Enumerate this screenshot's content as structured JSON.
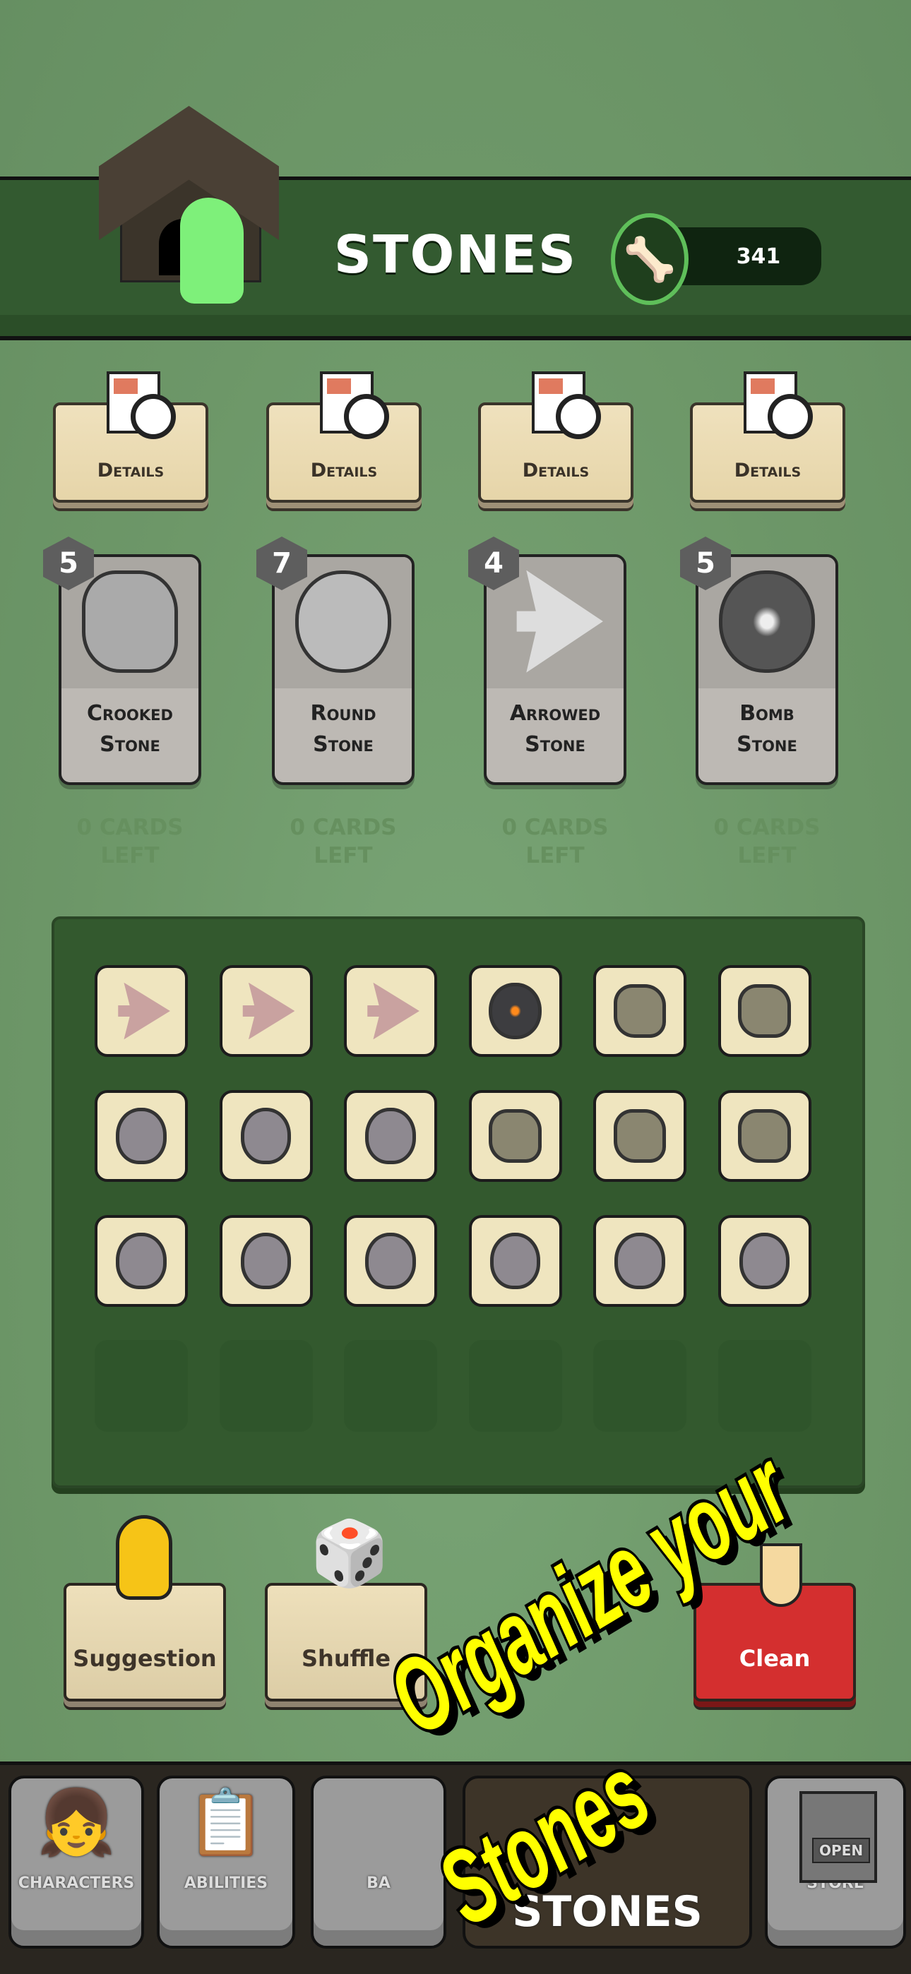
{
  "header": {
    "title": "STONES",
    "currency_value": "341",
    "currency_icon": "bone-icon"
  },
  "stones": [
    {
      "details_label": "Details",
      "count": "5",
      "name_line1": "Crooked",
      "name_line2": "Stone",
      "cards_left": "0 CARDS",
      "cards_left2": "LEFT"
    },
    {
      "details_label": "Details",
      "count": "7",
      "name_line1": "Round",
      "name_line2": "Stone",
      "cards_left": "0 CARDS",
      "cards_left2": "LEFT"
    },
    {
      "details_label": "Details",
      "count": "4",
      "name_line1": "Arrowed",
      "name_line2": "Stone",
      "cards_left": "0 CARDS",
      "cards_left2": "LEFT"
    },
    {
      "details_label": "Details",
      "count": "5",
      "name_line1": "Bomb",
      "name_line2": "Stone",
      "cards_left": "0 CARDS",
      "cards_left2": "LEFT"
    }
  ],
  "grid": [
    [
      "arrowed",
      "arrowed",
      "arrowed",
      "bomb",
      "crooked",
      "crooked"
    ],
    [
      "round",
      "round",
      "round",
      "crooked",
      "crooked",
      "crooked"
    ],
    [
      "round",
      "round",
      "round",
      "round",
      "round",
      "round"
    ],
    [
      "empty",
      "empty",
      "empty",
      "empty",
      "empty",
      "empty"
    ]
  ],
  "actions": {
    "suggestion": "Suggestion",
    "shuffle": "Shuffle",
    "clean": "Clean"
  },
  "nav": {
    "characters": "CHARACTERS",
    "abilities": "ABILITIES",
    "third": "BA",
    "stones": "STONES",
    "store": "STORE",
    "store_sign": "OPEN"
  },
  "overlay": {
    "line1": "Organize your",
    "line2": "Stones"
  },
  "colors": {
    "header": "#335a30",
    "panel": "#33592e",
    "clean": "#d42f2f",
    "overlay_text": "#ffff00"
  }
}
